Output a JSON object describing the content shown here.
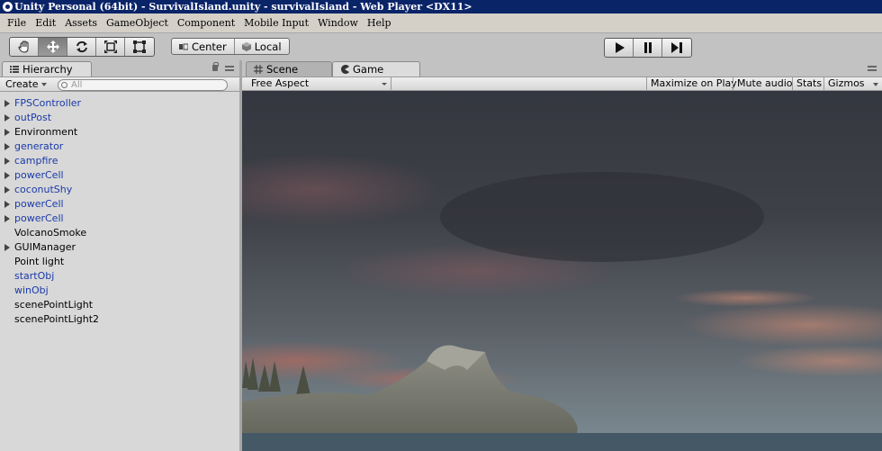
{
  "window": {
    "title": "Unity Personal (64bit) - SurvivalIsland.unity - survivalIsland - Web Player <DX11>"
  },
  "menu": [
    "File",
    "Edit",
    "Assets",
    "GameObject",
    "Component",
    "Mobile Input",
    "Window",
    "Help"
  ],
  "toolbar": {
    "tools": [
      "hand-icon",
      "move-icon",
      "rotate-icon",
      "scale-icon",
      "rect-icon"
    ],
    "pivot_mode": "Center",
    "pivot_space": "Local",
    "playback": [
      "play-icon",
      "pause-icon",
      "step-icon"
    ]
  },
  "hierarchy": {
    "tab_label": "Hierarchy",
    "create_label": "Create",
    "search_placeholder": "All",
    "items": [
      {
        "label": "FPSController",
        "expandable": true,
        "prefab": true
      },
      {
        "label": "outPost",
        "expandable": true,
        "prefab": true
      },
      {
        "label": "Environment",
        "expandable": true,
        "prefab": false
      },
      {
        "label": "generator",
        "expandable": true,
        "prefab": true
      },
      {
        "label": "campfire",
        "expandable": true,
        "prefab": true
      },
      {
        "label": "powerCell",
        "expandable": true,
        "prefab": true
      },
      {
        "label": "coconutShy",
        "expandable": true,
        "prefab": true
      },
      {
        "label": "powerCell",
        "expandable": true,
        "prefab": true
      },
      {
        "label": "powerCell",
        "expandable": true,
        "prefab": true
      },
      {
        "label": "VolcanoSmoke",
        "expandable": false,
        "prefab": false
      },
      {
        "label": "GUIManager",
        "expandable": true,
        "prefab": false
      },
      {
        "label": "Point light",
        "expandable": false,
        "prefab": false
      },
      {
        "label": "startObj",
        "expandable": false,
        "prefab": true
      },
      {
        "label": "winObj",
        "expandable": false,
        "prefab": true
      },
      {
        "label": "scenePointLight",
        "expandable": false,
        "prefab": false
      },
      {
        "label": "scenePointLight2",
        "expandable": false,
        "prefab": false
      }
    ]
  },
  "game_view": {
    "tabs": [
      {
        "label": "Scene",
        "icon": "scene-grid-icon",
        "active": false
      },
      {
        "label": "Game",
        "icon": "pacman-icon",
        "active": true
      }
    ],
    "aspect": "Free Aspect",
    "buttons": [
      "Maximize on Play",
      "Mute audio",
      "Stats",
      "Gizmos"
    ]
  },
  "colors": {
    "title_bar": "#0a2468",
    "prefab_text": "#1a3aa8",
    "panel_bg": "#c2c2c2",
    "list_bg": "#d8d8d8"
  }
}
